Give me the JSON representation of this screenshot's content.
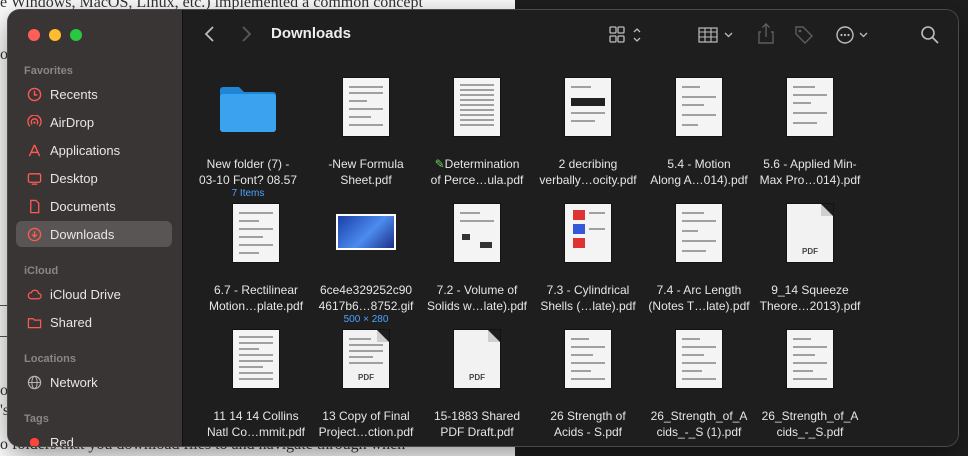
{
  "background_doc": {
    "line1": "e Windows, MacOS, Linux, etc.) implemented a common concept",
    "line2": "os",
    "line3": "ov",
    "line4": "'s",
    "line5": "o folders that you download files to and navigate through when"
  },
  "window": {
    "title": "Downloads",
    "colors": {
      "red": "#ff5f57",
      "yellow": "#febc2e",
      "green": "#28c840",
      "accent": "#ff453a",
      "sidebar_bg": "#3a3535",
      "main_bg": "#1e1e1e"
    }
  },
  "sidebar": {
    "favorites_header": "Favorites",
    "favorites": [
      {
        "label": "Recents",
        "icon": "clock-icon"
      },
      {
        "label": "AirDrop",
        "icon": "airdrop-icon"
      },
      {
        "label": "Applications",
        "icon": "applications-icon"
      },
      {
        "label": "Desktop",
        "icon": "desktop-icon"
      },
      {
        "label": "Documents",
        "icon": "document-icon"
      },
      {
        "label": "Downloads",
        "icon": "download-icon",
        "selected": true
      }
    ],
    "icloud_header": "iCloud",
    "icloud": [
      {
        "label": "iCloud Drive",
        "icon": "cloud-icon"
      },
      {
        "label": "Shared",
        "icon": "shared-folder-icon"
      }
    ],
    "locations_header": "Locations",
    "locations": [
      {
        "label": "Network",
        "icon": "globe-icon"
      }
    ],
    "tags_header": "Tags",
    "tags": [
      {
        "label": "Red",
        "color": "#ff453a"
      }
    ]
  },
  "files": [
    {
      "name1": "New folder (7) -",
      "name2": "03-10 Font? 08.57",
      "sub": "7 Items",
      "kind": "folder"
    },
    {
      "name1": "-New Formula",
      "name2": "Sheet.pdf",
      "kind": "doc"
    },
    {
      "name1": "Determination",
      "name2": "of Perce…ula.pdf",
      "kind": "doc",
      "prefix_icon": "pencil-icon"
    },
    {
      "name1": "2 decribing",
      "name2": "verbally…ocity.pdf",
      "kind": "doc"
    },
    {
      "name1": "5.4 - Motion",
      "name2": "Along A…014).pdf",
      "kind": "doc"
    },
    {
      "name1": "5.6 - Applied Min-",
      "name2": "Max Pro…014).pdf",
      "kind": "doc"
    },
    {
      "name1": "6.7 - Rectilinear",
      "name2": "Motion…plate.pdf",
      "kind": "doc"
    },
    {
      "name1": "6ce4e329252c90",
      "name2": "4617b6…8752.gif",
      "sub": "500 × 280",
      "kind": "image"
    },
    {
      "name1": "7.2 - Volume of",
      "name2": "Solids w…late).pdf",
      "kind": "doc"
    },
    {
      "name1": "7.3 - Cylindrical",
      "name2": "Shells (…late).pdf",
      "kind": "doc"
    },
    {
      "name1": "7.4 - Arc Length",
      "name2": "(Notes T…late).pdf",
      "kind": "doc"
    },
    {
      "name1": "9_14 Squeeze",
      "name2": "Theore…2013).pdf",
      "kind": "pdf",
      "badge": "PDF"
    },
    {
      "name1": "11 14 14 Collins",
      "name2": "Natl Co…mmit.pdf",
      "kind": "doc"
    },
    {
      "name1": "13 Copy of Final",
      "name2": "Project…ction.pdf",
      "kind": "pdf",
      "badge": "PDF"
    },
    {
      "name1": "15-1883 Shared",
      "name2": "PDF Draft.pdf",
      "kind": "pdf",
      "badge": "PDF"
    },
    {
      "name1": "26 Strength of",
      "name2": "Acids - S.pdf",
      "kind": "doc"
    },
    {
      "name1": "26_Strength_of_A",
      "name2": "cids_-_S (1).pdf",
      "kind": "doc"
    },
    {
      "name1": "26_Strength_of_A",
      "name2": "cids_-_S.pdf",
      "kind": "doc"
    }
  ]
}
